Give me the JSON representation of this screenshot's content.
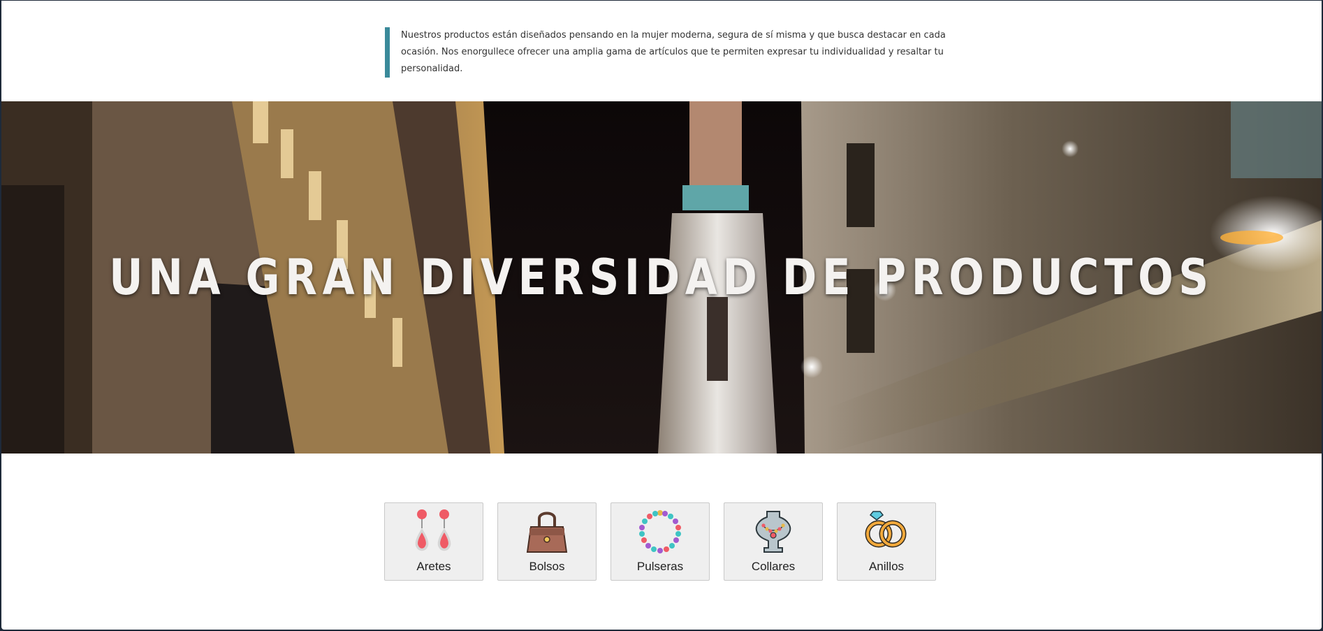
{
  "intro": {
    "text": "Nuestros productos están diseñados pensando en la mujer moderna, segura de sí misma y que busca destacar en cada ocasión. Nos enorgullece ofrecer una amplia gama de artículos que te permiten expresar tu individualidad y resaltar tu personalidad.",
    "accent_color": "#3a8a9a"
  },
  "hero": {
    "title": "UNA GRAN DIVERSIDAD DE PRODUCTOS"
  },
  "categories": [
    {
      "label": "Aretes",
      "icon": "earrings-icon"
    },
    {
      "label": "Bolsos",
      "icon": "handbag-icon"
    },
    {
      "label": "Pulseras",
      "icon": "bracelet-icon"
    },
    {
      "label": "Collares",
      "icon": "necklace-icon"
    },
    {
      "label": "Anillos",
      "icon": "rings-icon"
    }
  ]
}
